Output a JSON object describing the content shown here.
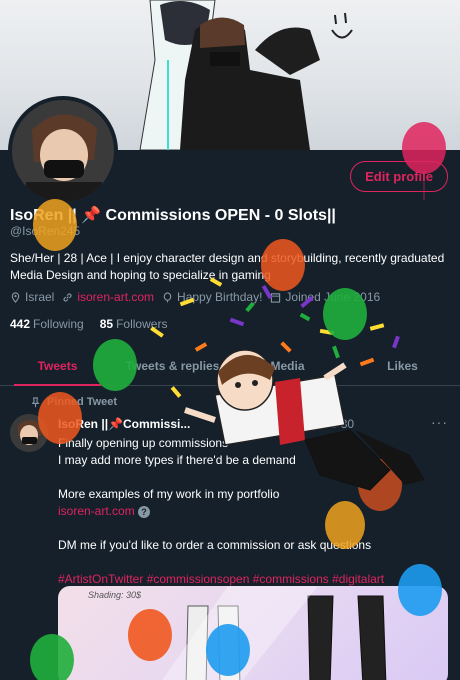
{
  "profile": {
    "edit_label": "Edit profile",
    "display_name": "IsoRen || 📌 Commissions OPEN - 0 Slots||",
    "handle": "@IsoRen245",
    "bio": "She/Her | 28 | Ace | I enjoy character design and storybuilding, recently graduated Media Design and hoping to specialize in gaming",
    "location": "Israel",
    "website": "isoren-art.com",
    "birthday": "Happy Birthday!",
    "joined": "Joined June 2016",
    "following_count": "442",
    "following_label": "Following",
    "followers_count": "85",
    "followers_label": "Followers"
  },
  "tabs": [
    "Tweets",
    "Tweets & replies",
    "Media",
    "Likes"
  ],
  "tweet": {
    "pinned_label": "Pinned Tweet",
    "name": "IsoRen ||📌Commissi...",
    "handle_time": "Ren245 · Mar 30",
    "line1": "Finally opening up commissions",
    "line2": "I may add more types if there'd be a demand",
    "line3": "More examples of my work in my portfolio",
    "link": "isoren-art.com",
    "line4": "DM me if you'd like to order a commission or ask questions",
    "hashtags": "#ArtistOnTwitter #commissionsopen #commissions #digitalart",
    "media_label": "Shading: 30$"
  },
  "colors": {
    "accent": "#e0245e",
    "background": "#15202b",
    "muted": "#8899a6"
  }
}
